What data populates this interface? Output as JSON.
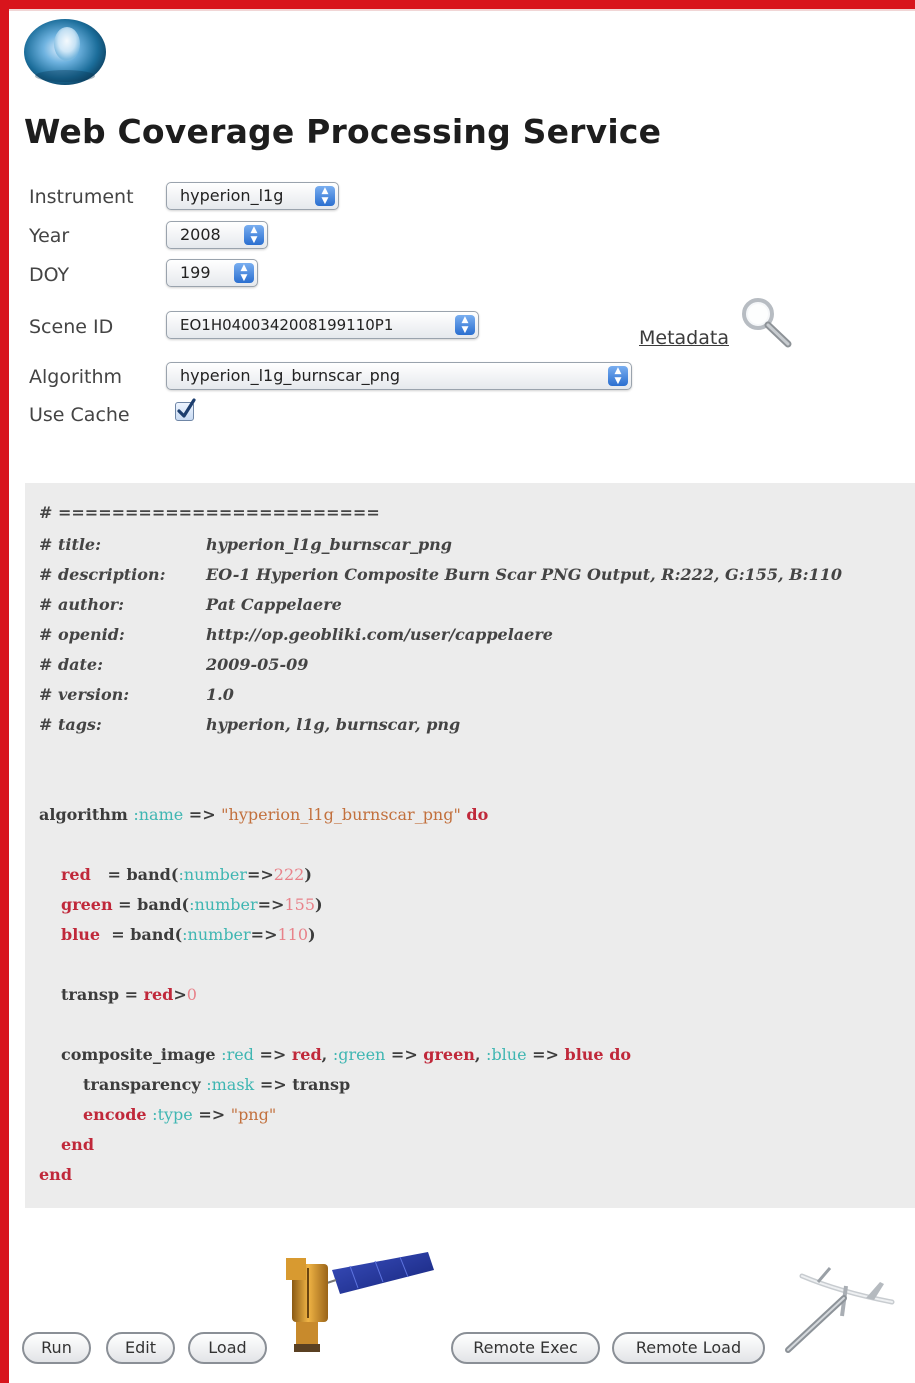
{
  "header": {
    "title": "Web Coverage Processing Service"
  },
  "form": {
    "instrument": {
      "label": "Instrument",
      "value": "hyperion_l1g"
    },
    "year": {
      "label": "Year",
      "value": "2008"
    },
    "doy": {
      "label": "DOY",
      "value": "199"
    },
    "scene_id": {
      "label": "Scene ID",
      "value": "EO1H0400342008199110P1"
    },
    "metadata_link": "Metadata",
    "algorithm": {
      "label": "Algorithm",
      "value": "hyperion_l1g_burnscar_png"
    },
    "use_cache": {
      "label": "Use Cache",
      "checked": true
    }
  },
  "code": {
    "separator": "# ========================",
    "header_rows": [
      {
        "key": "# title:",
        "value": "hyperion_l1g_burnscar_png"
      },
      {
        "key": "# description:",
        "value": "EO-1 Hyperion Composite Burn Scar PNG Output, R:222, G:155, B:110"
      },
      {
        "key": "# author:",
        "value": "Pat Cappelaere"
      },
      {
        "key": "# openid:",
        "value": "http://op.geobliki.com/user/cappelaere"
      },
      {
        "key": "# date:",
        "value": "2009-05-09"
      },
      {
        "key": "# version:",
        "value": "1.0"
      },
      {
        "key": "# tags:",
        "value": "hyperion, l1g, burnscar, png"
      }
    ],
    "algorithm_name": "\"hyperion_l1g_burnscar_png\"",
    "band_red": "222",
    "band_green": "155",
    "band_blue": "110",
    "transp_threshold": "0",
    "encode_type": "\"png\""
  },
  "buttons": {
    "run": "Run",
    "edit": "Edit",
    "load": "Load",
    "remote_exec": "Remote Exec",
    "remote_load": "Remote Load"
  },
  "icons": {
    "logo": "globe-logo-icon",
    "metadata": "magnifier-icon",
    "satellite": "satellite-icon",
    "aircraft": "aircraft-icon"
  },
  "colors": {
    "frame": "#d8141c",
    "code_background": "#ececec",
    "keyword": "#c0283a",
    "symbol": "#3fb6b2",
    "string": "#c2703d",
    "number": "#e8828a"
  }
}
